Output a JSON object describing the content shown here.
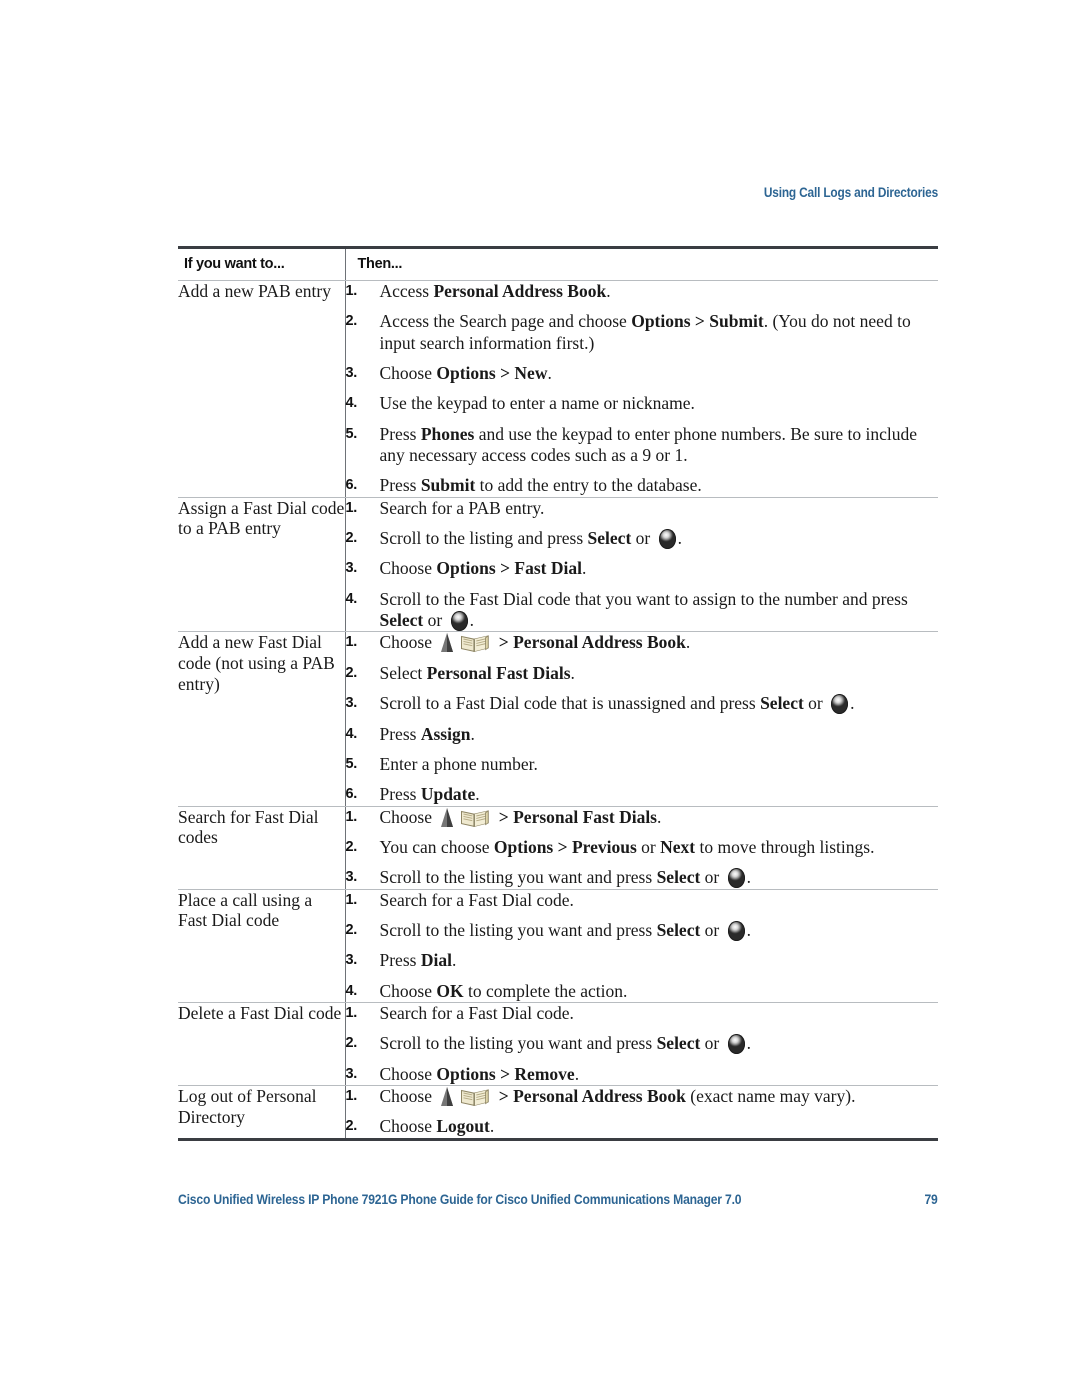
{
  "header": {
    "running_head": "Using Call Logs and Directories",
    "accent_color": "#2d6593"
  },
  "table": {
    "columns": [
      "If you want to...",
      "Then..."
    ],
    "rows": [
      {
        "want": "Add a new PAB entry",
        "steps": [
          {
            "num": "1.",
            "parts": [
              {
                "t": "Access ",
                "b": false
              },
              {
                "t": "Personal Address Book",
                "b": true
              },
              {
                "t": ".",
                "b": false
              }
            ]
          },
          {
            "num": "2.",
            "parts": [
              {
                "t": "Access the Search page and choose ",
                "b": false
              },
              {
                "t": "Options > Submit",
                "b": true
              },
              {
                "t": ". (You do not need to input search information first.)",
                "b": false
              }
            ]
          },
          {
            "num": "3.",
            "parts": [
              {
                "t": "Choose ",
                "b": false
              },
              {
                "t": "Options > New",
                "b": true
              },
              {
                "t": ".",
                "b": false
              }
            ]
          },
          {
            "num": "4.",
            "parts": [
              {
                "t": "Use the keypad to enter a name or nickname.",
                "b": false
              }
            ]
          },
          {
            "num": "5.",
            "parts": [
              {
                "t": "Press ",
                "b": false
              },
              {
                "t": "Phones",
                "b": true
              },
              {
                "t": " and use the keypad to enter phone numbers. Be sure to include any necessary access codes such as a 9 or 1.",
                "b": false
              }
            ]
          },
          {
            "num": "6.",
            "parts": [
              {
                "t": "Press ",
                "b": false
              },
              {
                "t": "Submit",
                "b": true
              },
              {
                "t": " to add the entry to the database.",
                "b": false
              }
            ]
          }
        ]
      },
      {
        "want": "Assign a Fast Dial code to a PAB entry",
        "steps": [
          {
            "num": "1.",
            "parts": [
              {
                "t": "Search for a PAB entry.",
                "b": false
              }
            ]
          },
          {
            "num": "2.",
            "parts": [
              {
                "t": "Scroll to the listing and press ",
                "b": false
              },
              {
                "t": "Select",
                "b": true
              },
              {
                "t": " or ",
                "b": false
              },
              {
                "icon": "select-button-icon"
              },
              {
                "t": ".",
                "b": false
              }
            ]
          },
          {
            "num": "3.",
            "parts": [
              {
                "t": "Choose ",
                "b": false
              },
              {
                "t": "Options > Fast Dial",
                "b": true
              },
              {
                "t": ".",
                "b": false
              }
            ]
          },
          {
            "num": "4.",
            "parts": [
              {
                "t": "Scroll to the Fast Dial code that you want to assign to the number and press ",
                "b": false
              },
              {
                "t": "Select",
                "b": true
              },
              {
                "t": " or ",
                "b": false
              },
              {
                "icon": "select-button-icon"
              },
              {
                "t": ".",
                "b": false
              }
            ]
          }
        ]
      },
      {
        "want": "Add a new Fast Dial code (not using a PAB entry)",
        "steps": [
          {
            "num": "1.",
            "parts": [
              {
                "t": "Choose ",
                "b": false
              },
              {
                "icon": "navigation-triangle-icon"
              },
              {
                "icon": "directories-book-icon"
              },
              {
                "t": " > ",
                "b": true
              },
              {
                "t": "Personal Address Book",
                "b": true
              },
              {
                "t": ".",
                "b": false
              }
            ]
          },
          {
            "num": "2.",
            "parts": [
              {
                "t": "Select ",
                "b": false
              },
              {
                "t": "Personal Fast Dials",
                "b": true
              },
              {
                "t": ".",
                "b": false
              }
            ]
          },
          {
            "num": "3.",
            "parts": [
              {
                "t": "Scroll to a Fast Dial code that is unassigned and press ",
                "b": false
              },
              {
                "t": "Select",
                "b": true
              },
              {
                "t": " or ",
                "b": false
              },
              {
                "icon": "select-button-icon"
              },
              {
                "t": ".",
                "b": false
              }
            ]
          },
          {
            "num": "4.",
            "parts": [
              {
                "t": "Press ",
                "b": false
              },
              {
                "t": "Assign",
                "b": true
              },
              {
                "t": ".",
                "b": false
              }
            ]
          },
          {
            "num": "5.",
            "parts": [
              {
                "t": "Enter a phone number.",
                "b": false
              }
            ]
          },
          {
            "num": "6.",
            "parts": [
              {
                "t": "Press ",
                "b": false
              },
              {
                "t": "Update",
                "b": true
              },
              {
                "t": ".",
                "b": false
              }
            ]
          }
        ]
      },
      {
        "want": "Search for Fast Dial codes",
        "steps": [
          {
            "num": "1.",
            "parts": [
              {
                "t": "Choose ",
                "b": false
              },
              {
                "icon": "navigation-triangle-icon"
              },
              {
                "icon": "directories-book-icon"
              },
              {
                "t": " > ",
                "b": true
              },
              {
                "t": "Personal Fast Dials",
                "b": true
              },
              {
                "t": ".",
                "b": false
              }
            ]
          },
          {
            "num": "2.",
            "parts": [
              {
                "t": "You can choose ",
                "b": false
              },
              {
                "t": "Options > Previous",
                "b": true
              },
              {
                "t": " or ",
                "b": false
              },
              {
                "t": "Next",
                "b": true
              },
              {
                "t": " to move through listings.",
                "b": false
              }
            ]
          },
          {
            "num": "3.",
            "parts": [
              {
                "t": "Scroll to the listing you want and press ",
                "b": false
              },
              {
                "t": "Select",
                "b": true
              },
              {
                "t": " or ",
                "b": false
              },
              {
                "icon": "select-button-icon"
              },
              {
                "t": ".",
                "b": false
              }
            ]
          }
        ]
      },
      {
        "want": "Place a call using a Fast Dial code",
        "steps": [
          {
            "num": "1.",
            "parts": [
              {
                "t": "Search for a Fast Dial code.",
                "b": false
              }
            ]
          },
          {
            "num": "2.",
            "parts": [
              {
                "t": "Scroll to the listing you want and press ",
                "b": false
              },
              {
                "t": "Select",
                "b": true
              },
              {
                "t": " or ",
                "b": false
              },
              {
                "icon": "select-button-icon"
              },
              {
                "t": ".",
                "b": false
              }
            ]
          },
          {
            "num": "3.",
            "parts": [
              {
                "t": "Press ",
                "b": false
              },
              {
                "t": "Dial",
                "b": true
              },
              {
                "t": ".",
                "b": false
              }
            ]
          },
          {
            "num": "4.",
            "parts": [
              {
                "t": "Choose ",
                "b": false
              },
              {
                "t": "OK",
                "b": true
              },
              {
                "t": " to complete the action.",
                "b": false
              }
            ]
          }
        ]
      },
      {
        "want": "Delete a Fast Dial code",
        "steps": [
          {
            "num": "1.",
            "parts": [
              {
                "t": "Search for a Fast Dial code.",
                "b": false
              }
            ]
          },
          {
            "num": "2.",
            "parts": [
              {
                "t": "Scroll to the listing you want and press ",
                "b": false
              },
              {
                "t": "Select",
                "b": true
              },
              {
                "t": " or ",
                "b": false
              },
              {
                "icon": "select-button-icon"
              },
              {
                "t": ".",
                "b": false
              }
            ]
          },
          {
            "num": "3.",
            "parts": [
              {
                "t": "Choose ",
                "b": false
              },
              {
                "t": "Options > Remove",
                "b": true
              },
              {
                "t": ".",
                "b": false
              }
            ]
          }
        ]
      },
      {
        "want": "Log out of Personal Directory",
        "steps": [
          {
            "num": "1.",
            "parts": [
              {
                "t": "Choose ",
                "b": false
              },
              {
                "icon": "navigation-triangle-icon"
              },
              {
                "icon": "directories-book-icon"
              },
              {
                "t": " > ",
                "b": true
              },
              {
                "t": "Personal Address Book",
                "b": true
              },
              {
                "t": " (exact name may vary).",
                "b": false
              }
            ]
          },
          {
            "num": "2.",
            "parts": [
              {
                "t": "Choose ",
                "b": false
              },
              {
                "t": "Logout",
                "b": true
              },
              {
                "t": ".",
                "b": false
              }
            ]
          }
        ]
      }
    ]
  },
  "footer": {
    "doc_title": "Cisco Unified Wireless IP Phone 7921G Phone Guide for Cisco Unified Communications Manager 7.0",
    "page_number": "79"
  }
}
